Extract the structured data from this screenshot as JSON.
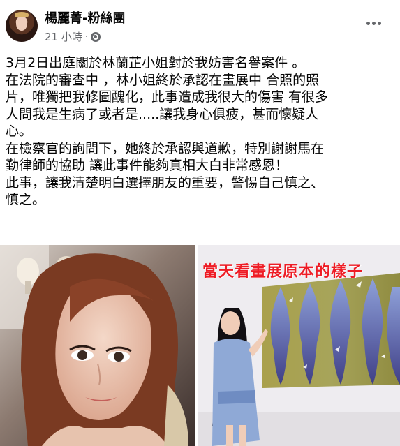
{
  "post": {
    "author": "楊麗菁-粉絲團",
    "time": "21 小時",
    "separator": "·",
    "lines": [
      "3月2日出庭關於林蘭芷小姐對於我妨害名譽案件 。",
      "在法院的審查中 ，林小姐終於承認在畫展中 合照的照",
      "片，唯獨把我修圖醜化，此事造成我很大的傷害 有很多",
      "人問我是生病了或者是.....讓我身心俱疲，甚而懷疑人",
      "心。",
      "在檢察官的詢問下，她終於承認與道歉，特別謝謝馬在",
      "勤律師的協助  讓此事件能夠真相大白非常感恩！",
      "此事，讓我清楚明白選擇朋友的重要，警惕自己慎之、",
      "慎之。"
    ]
  },
  "photos": {
    "right_caption": "當天看畫展原本的樣子"
  },
  "icons": {
    "privacy": "globe-icon",
    "menu": "more-icon"
  },
  "colors": {
    "meta_gray": "#65676b",
    "caption_red": "#ee1c25",
    "canvas_blue": "#6f7fb4"
  }
}
